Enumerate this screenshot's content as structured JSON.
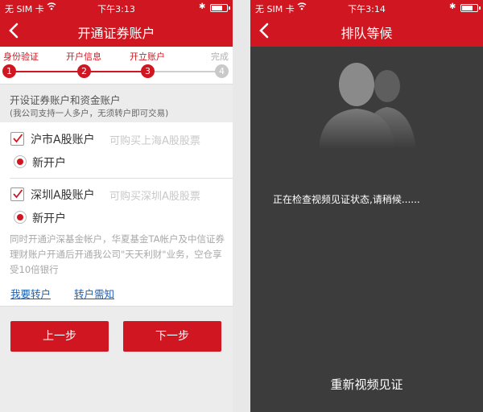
{
  "left": {
    "status": {
      "carrier": "无 SIM 卡",
      "time": "下午3:13"
    },
    "nav": {
      "title": "开通证券账户"
    },
    "steps": [
      {
        "label": "身份验证",
        "num": "1"
      },
      {
        "label": "开户信息",
        "num": "2"
      },
      {
        "label": "开立账户",
        "num": "3"
      },
      {
        "label": "完成",
        "num": "4"
      }
    ],
    "section": {
      "title": "开设证券账户和资金账户",
      "subtitle": "(我公司支持一人多户，无须转户即可交易)"
    },
    "accounts": [
      {
        "name": "沪市A股账户",
        "hint": "可购买上海A股股票",
        "option": "新开户"
      },
      {
        "name": "深圳A股账户",
        "hint": "可购买深圳A股股票",
        "option": "新开户"
      }
    ],
    "note": "同时开通沪深基金帐户，华夏基金TA帐户及中信证券理财账户开通后开通我公司\"天天利财\"业务，空仓享受10倍银行",
    "links": {
      "transfer": "我要转户",
      "notice": "转户需知"
    },
    "buttons": {
      "prev": "上一步",
      "next": "下一步"
    },
    "accent_color": "#d01620"
  },
  "right": {
    "status": {
      "carrier": "无 SIM 卡",
      "time": "下午3:14"
    },
    "nav": {
      "title": "排队等候"
    },
    "message": "正在检查视频见证状态,请稍候......",
    "retry_label": "重新视频见证"
  }
}
